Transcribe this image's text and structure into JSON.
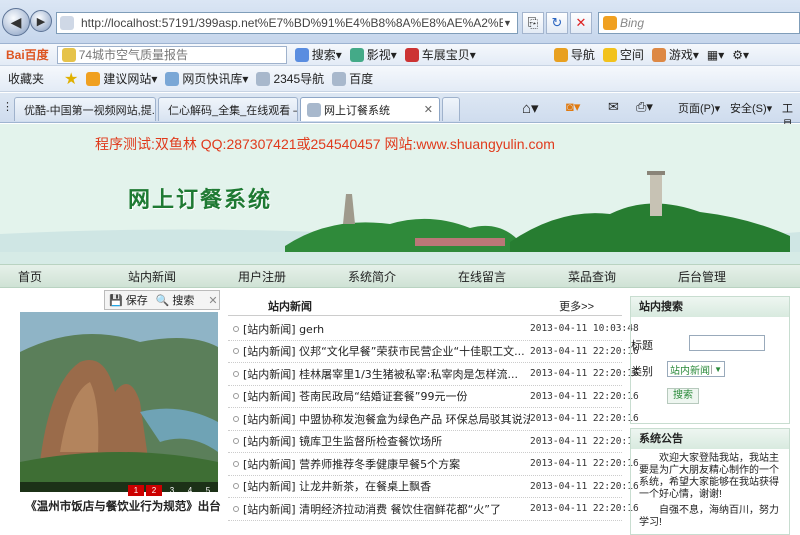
{
  "browser": {
    "url": "http://localhost:57191/399asp.net%E7%BD%91%E4%B8%8A%E8%AE%A2%E9%A4%90%E7%B",
    "search_placeholder": "Bing"
  },
  "toolbar1": {
    "brand": "Bai百度",
    "weather": "74城市空气质量报告",
    "search": "搜索",
    "video": "影视",
    "car": "车展宝贝",
    "nav": "导航",
    "space": "空间",
    "game": "游戏"
  },
  "favbar": {
    "label": "收藏夹",
    "items": [
      "建议网站",
      "网页快讯库",
      "2345导航",
      "百度"
    ]
  },
  "tabs": [
    {
      "label": "优酷-中国第一视频网站,提..."
    },
    {
      "label": "仁心解码_全集_在线观看 –..."
    },
    {
      "label": "网上订餐系统"
    }
  ],
  "cmdbar": {
    "page": "页面(P)",
    "safety": "安全(S)",
    "tools": "工具"
  },
  "page": {
    "tester": "程序测试:双鱼林 QQ:287307421或254540457 网站:www.shuangyulin.com",
    "site_title": "网上订餐系统",
    "nav": [
      "首页",
      "站内新闻",
      "用户注册",
      "系统简介",
      "在线留言",
      "菜品查询",
      "后台管理"
    ],
    "floatbar": {
      "save": "保存",
      "search": "搜索"
    },
    "slide_numbers": [
      "1",
      "2",
      "3",
      "4",
      "5"
    ],
    "slide_caption": "《温州市饭店与餐饮业行为规范》出台",
    "news_title": "站内新闻",
    "news_more": "更多>>",
    "news": [
      {
        "title": "[站内新闻] gerh",
        "date": "2013-04-11 10:03:48"
      },
      {
        "title": "[站内新闻] 仪邦“文化早餐”荣获市民营企业“十佳职工文...",
        "date": "2013-04-11 22:20:16"
      },
      {
        "title": "[站内新闻] 桂林屠宰里1/3生猪被私宰:私宰肉是怎样流...",
        "date": "2013-04-11 22:20:16"
      },
      {
        "title": "[站内新闻] 苍南民政局“结婚证套餐”99元一份",
        "date": "2013-04-11 22:20:16"
      },
      {
        "title": "[站内新闻] 中盟协称发泡餐盒为绿色产品 环保总局驳其说法",
        "date": "2013-04-11 22:20:16"
      },
      {
        "title": "[站内新闻] 镜库卫生监督所检查餐饮场所",
        "date": "2013-04-11 22:20:16"
      },
      {
        "title": "[站内新闻] 营养师推荐冬季健康早餐5个方案",
        "date": "2013-04-11 22:20:16"
      },
      {
        "title": "[站内新闻] 让龙井新茶，在餐桌上飘香",
        "date": "2013-04-11 22:20:16"
      },
      {
        "title": "[站内新闻] 清明经济拉动消费 餐饮住宿鲜花都“火”了",
        "date": "2013-04-11 22:20:16"
      }
    ],
    "search_box": {
      "title": "站内搜索",
      "label_title": "标题",
      "label_type": "类别",
      "type_value": "站内新闻",
      "button": "搜索"
    },
    "notice": {
      "title": "系统公告",
      "text1": "欢迎大家登陆我站，我站主要是为广大朋友精心制作的一个系统，希望大家能够在我站获得一个好心情，谢谢!",
      "text2": "自强不息，海纳百川，努力学习!"
    }
  }
}
